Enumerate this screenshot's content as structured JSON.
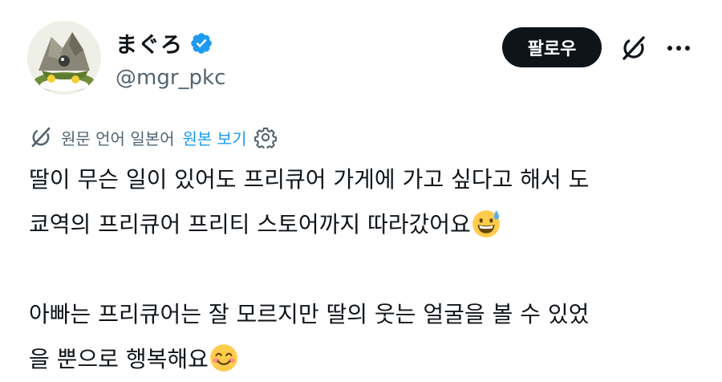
{
  "user": {
    "display_name": "まぐろ",
    "handle": "@mgr_pkc",
    "avatar_icon": "tuna-head-avatar",
    "verified_icon": "verified-badge-icon"
  },
  "actions": {
    "follow_label": "팔로우",
    "grok_icon": "grok-icon",
    "more_icon": "more-icon"
  },
  "translation": {
    "label": "원문 언어 일본어",
    "view_original": "원본 보기",
    "translate_icon": "grok-translate-icon",
    "settings_icon": "gear-icon"
  },
  "tweet": {
    "line1": "딸이 무슨 일이 있어도 프리큐어 가게에 가고 싶다고 해서 도",
    "line2": "쿄역의 프리큐어 프리티 스토어까지 따라갔어요",
    "line3": "아빠는 프리큐어는 잘 모르지만 딸의 웃는 얼굴을 볼 수 있었",
    "line4": "을 뿐으로 행복해요",
    "emoji1": "grinning-face-with-sweat-emoji",
    "emoji2": "smiling-face-with-blush-emoji"
  },
  "colors": {
    "text": "#0f1419",
    "secondary": "#536471",
    "link": "#1d9bf0",
    "button_bg": "#0f1419",
    "verified": "#1d9bf0"
  }
}
